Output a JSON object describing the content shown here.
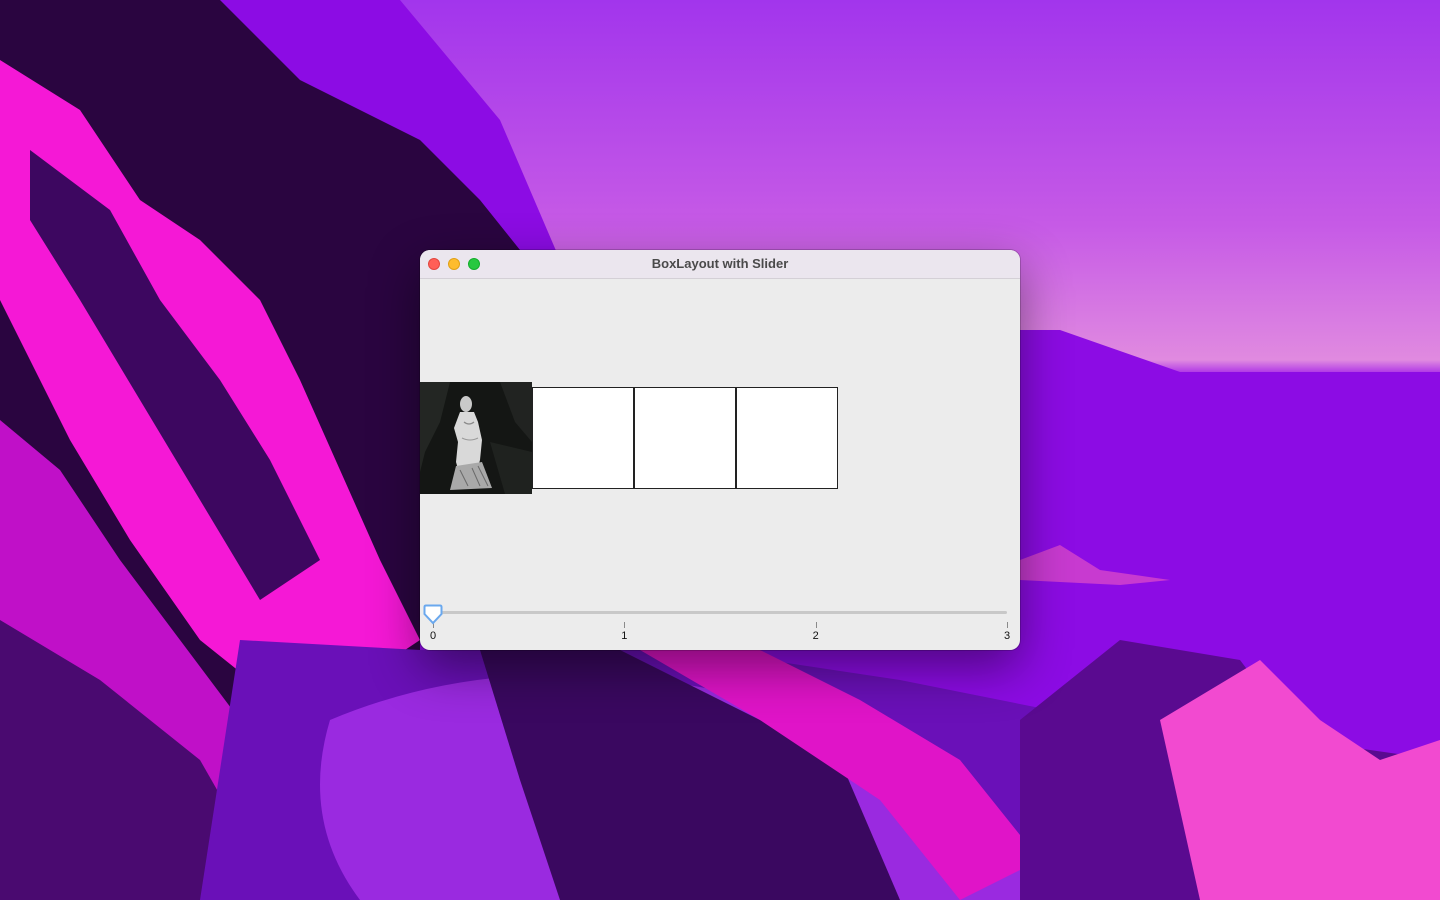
{
  "window": {
    "title": "BoxLayout with Slider"
  },
  "slider": {
    "min": 0,
    "max": 3,
    "value": 0,
    "tick_labels": [
      "0",
      "1",
      "2",
      "3"
    ]
  },
  "icons": {
    "close": "close-button",
    "minimize": "minimize-button",
    "zoom": "zoom-button",
    "image": "venus-statue-image"
  },
  "colors": {
    "accent": "#5aa0ee",
    "window_bg": "#ececec"
  }
}
